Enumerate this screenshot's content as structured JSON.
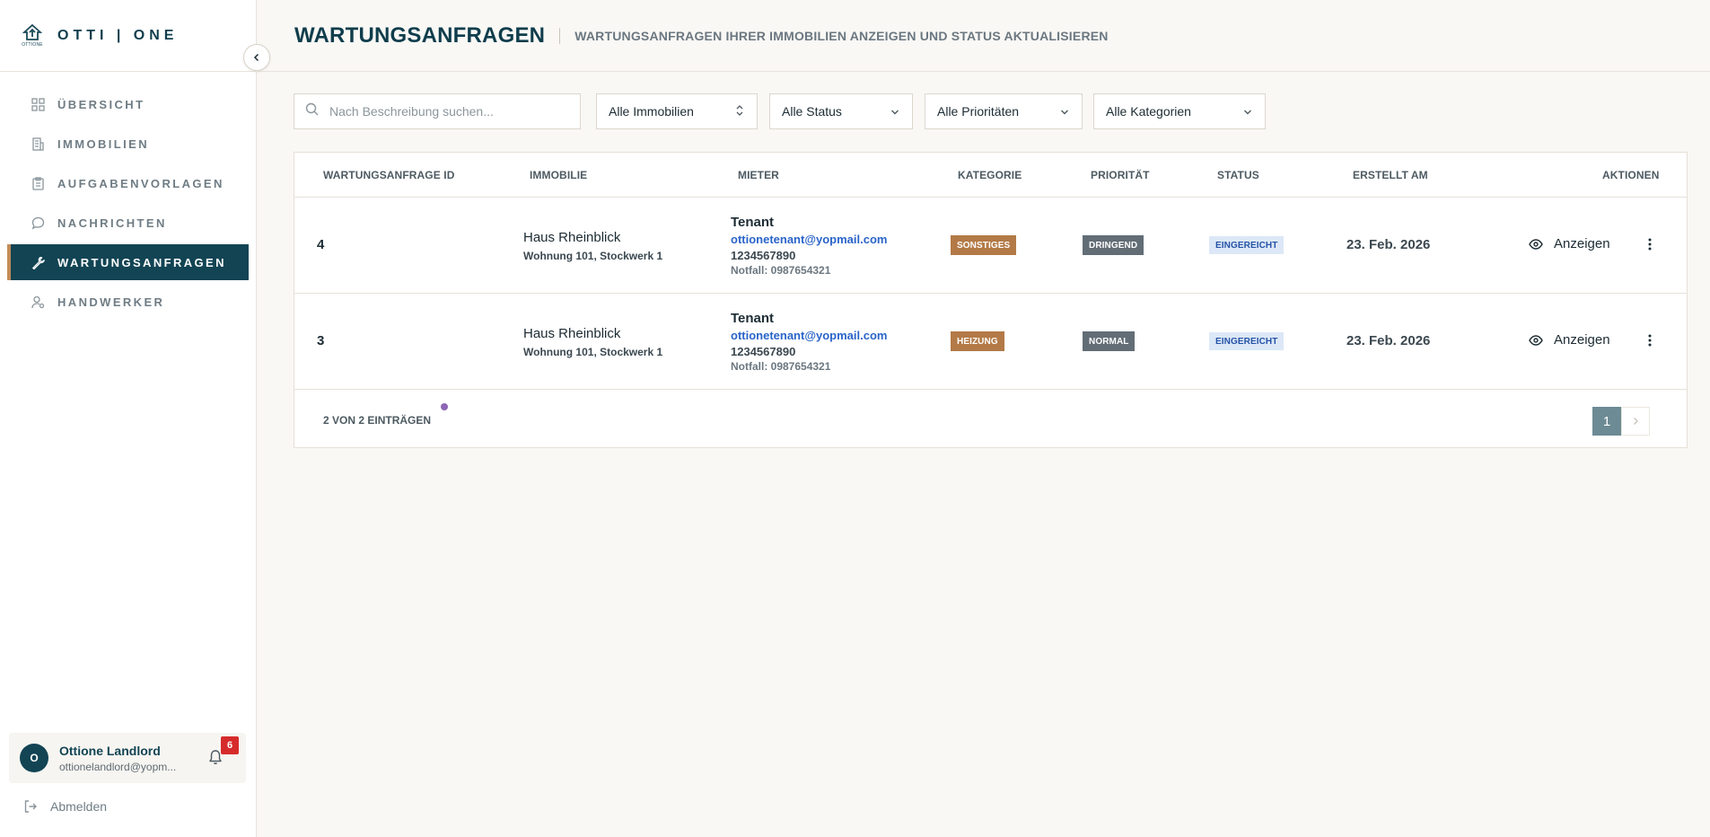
{
  "brand": {
    "logo_text": "OTTIONE",
    "name": "OTTI | ONE"
  },
  "sidebar": {
    "items": [
      {
        "label": "ÜBERSICHT",
        "icon": "dashboard-icon"
      },
      {
        "label": "IMMOBILIEN",
        "icon": "building-icon"
      },
      {
        "label": "AUFGABENVORLAGEN",
        "icon": "clipboard-icon"
      },
      {
        "label": "NACHRICHTEN",
        "icon": "chat-icon"
      },
      {
        "label": "WARTUNGSANFRAGEN",
        "icon": "wrench-icon",
        "active": true
      },
      {
        "label": "HANDWERKER",
        "icon": "user-gear-icon"
      }
    ]
  },
  "user": {
    "initial": "O",
    "name": "Ottione Landlord",
    "email": "ottionelandlord@yopm...",
    "notifications": "6"
  },
  "logout_label": "Abmelden",
  "header": {
    "title": "WARTUNGSANFRAGEN",
    "subtitle": "WARTUNGSANFRAGEN IHRER IMMOBILIEN ANZEIGEN UND STATUS AKTUALISIEREN"
  },
  "filters": {
    "search_placeholder": "Nach Beschreibung suchen...",
    "property": "Alle Immobilien",
    "status": "Alle Status",
    "priority": "Alle Prioritäten",
    "category": "Alle Kategorien"
  },
  "table": {
    "columns": [
      "WARTUNGSANFRAGE ID",
      "IMMOBILIE",
      "MIETER",
      "KATEGORIE",
      "PRIORITÄT",
      "STATUS",
      "ERSTELLT AM",
      "AKTIONEN"
    ],
    "rows": [
      {
        "id": "4",
        "property": "Haus Rheinblick",
        "unit": "Wohnung 101, Stockwerk 1",
        "tenant_name": "Tenant",
        "tenant_email": "ottionetenant@yopmail.com",
        "tenant_phone": "1234567890",
        "tenant_emergency": "Notfall: 0987654321",
        "category": "SONSTIGES",
        "priority": "DRINGEND",
        "status": "EINGEREICHT",
        "created": "23. Feb. 2026",
        "action": "Anzeigen"
      },
      {
        "id": "3",
        "property": "Haus Rheinblick",
        "unit": "Wohnung 101, Stockwerk 1",
        "tenant_name": "Tenant",
        "tenant_email": "ottionetenant@yopmail.com",
        "tenant_phone": "1234567890",
        "tenant_emergency": "Notfall: 0987654321",
        "category": "HEIZUNG",
        "priority": "NORMAL",
        "status": "EINGEREICHT",
        "created": "23. Feb. 2026",
        "action": "Anzeigen"
      }
    ],
    "footer_count": "2 VON 2 EINTRÄGEN",
    "current_page": "1"
  },
  "colors": {
    "primary": "#124454",
    "accent": "#c28b57",
    "category_badge": "#b37a47",
    "priority_badge": "#626d76",
    "status_badge_bg": "#dce8f7",
    "link": "#2a64c9",
    "notification": "#d62b2b"
  }
}
